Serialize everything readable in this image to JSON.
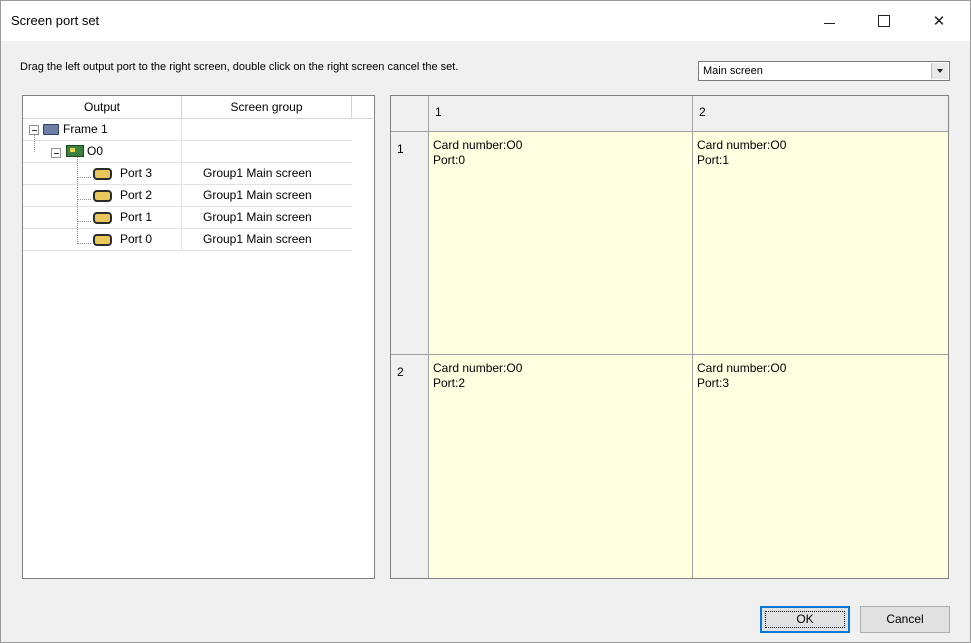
{
  "window": {
    "title": "Screen port set",
    "minimize_glyph": "",
    "close_glyph": "✕"
  },
  "instruction": "Drag the left output port to the right screen, double click on the right screen cancel the set.",
  "screen_select": {
    "value": "Main screen"
  },
  "tree": {
    "columns": [
      "Output",
      "Screen group"
    ],
    "frame": {
      "label": "Frame 1",
      "icon": "frame-icon"
    },
    "card": {
      "label": "O0",
      "icon": "card-icon"
    },
    "ports": [
      {
        "label": "Port 3",
        "group": "Group1 Main screen"
      },
      {
        "label": "Port 2",
        "group": "Group1 Main screen"
      },
      {
        "label": "Port 1",
        "group": "Group1 Main screen"
      },
      {
        "label": "Port 0",
        "group": "Group1 Main screen"
      }
    ]
  },
  "grid": {
    "col_headers": [
      "1",
      "2"
    ],
    "row_headers": [
      "1",
      "2"
    ],
    "cells": [
      [
        {
          "card": "Card number:O0",
          "port": "Port:0"
        },
        {
          "card": "Card number:O0",
          "port": "Port:1"
        }
      ],
      [
        {
          "card": "Card number:O0",
          "port": "Port:2"
        },
        {
          "card": "Card number:O0",
          "port": "Port:3"
        }
      ]
    ],
    "cell_color": "#ffffe1"
  },
  "buttons": {
    "ok": "OK",
    "cancel": "Cancel"
  }
}
